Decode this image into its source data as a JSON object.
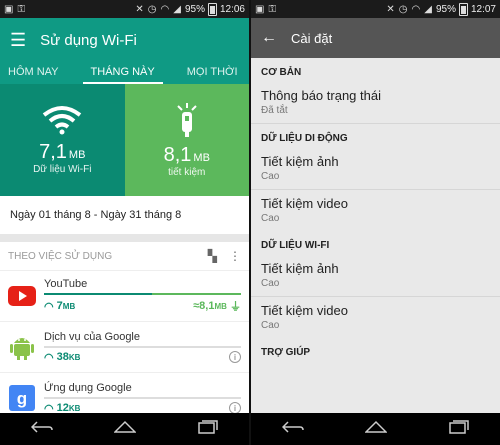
{
  "left": {
    "status": {
      "battery": "95%",
      "time": "12:06"
    },
    "appbar": {
      "title": "Sử dụng Wi-Fi"
    },
    "tabs": [
      "HÔM NAY",
      "THÁNG NÀY",
      "MỌI THỜI"
    ],
    "stats": {
      "wifi": {
        "value": "7,1",
        "unit": "MB",
        "label": "Dữ liệu Wi-Fi"
      },
      "saved": {
        "value": "8,1",
        "unit": "MB",
        "label": "tiết kiệm"
      }
    },
    "date_range": "Ngày 01 tháng 8 - Ngày 31 tháng 8",
    "list": {
      "header": "THEO VIỆC SỬ DỤNG",
      "apps": [
        {
          "name": "YouTube",
          "used": "7",
          "used_unit": "MB",
          "saved": "≈8,1",
          "saved_unit": "MB",
          "used_fraction": 0.55,
          "saved_fraction": 0.45
        },
        {
          "name": "Dịch vụ của Google",
          "used": "38",
          "used_unit": "KB",
          "used_fraction": 0.0
        },
        {
          "name": "Ứng dụng Google",
          "used": "12",
          "used_unit": "KB",
          "used_fraction": 0.0
        }
      ]
    }
  },
  "right": {
    "status": {
      "battery": "95%",
      "time": "12:07"
    },
    "appbar": {
      "title": "Cài đặt"
    },
    "sections": [
      {
        "title": "CƠ BẢN",
        "items": [
          {
            "title": "Thông báo trạng thái",
            "sub": "Đã tắt"
          }
        ]
      },
      {
        "title": "DỮ LIỆU DI ĐỘNG",
        "items": [
          {
            "title": "Tiết kiệm ảnh",
            "sub": "Cao"
          },
          {
            "title": "Tiết kiệm video",
            "sub": "Cao"
          }
        ]
      },
      {
        "title": "DỮ LIỆU WI-FI",
        "items": [
          {
            "title": "Tiết kiệm ảnh",
            "sub": "Cao"
          },
          {
            "title": "Tiết kiệm video",
            "sub": "Cao"
          }
        ]
      },
      {
        "title": "TRỢ GIÚP",
        "items": []
      }
    ]
  },
  "colors": {
    "teal": "#0f9a84",
    "green": "#5cb85c",
    "youtube_red": "#e62117",
    "android_green": "#8bc34a",
    "google_blue": "#4285f4"
  }
}
